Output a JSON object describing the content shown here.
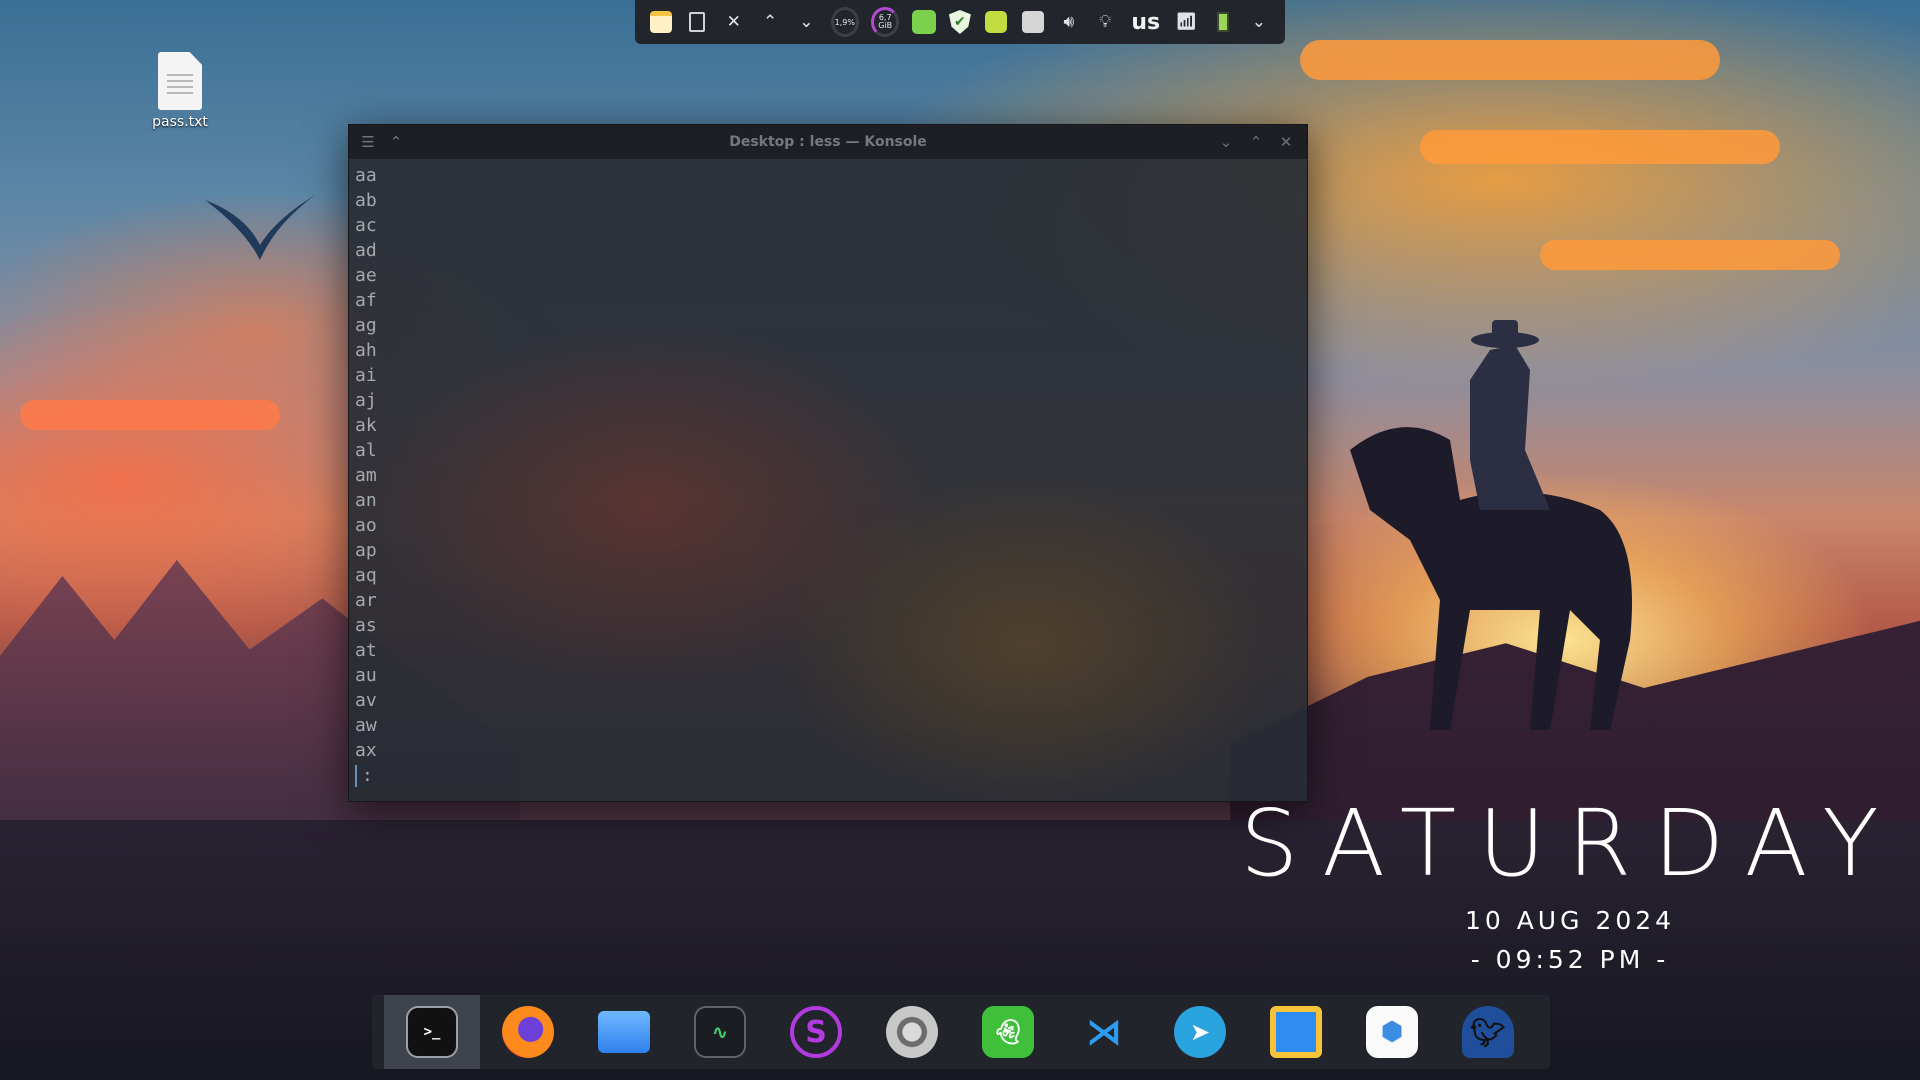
{
  "top_panel": {
    "cpu_usage": "1,9%",
    "mem_usage_value": "6,7",
    "mem_usage_unit": "GiB",
    "keyboard_layout": "us"
  },
  "desktop": {
    "icons": [
      {
        "label": "pass.txt",
        "icon": "text-file-icon"
      }
    ]
  },
  "konsole": {
    "title": "Desktop : less — Konsole",
    "lines": [
      "aa",
      "ab",
      "ac",
      "ad",
      "ae",
      "af",
      "ag",
      "ah",
      "ai",
      "aj",
      "ak",
      "al",
      "am",
      "an",
      "ao",
      "ap",
      "aq",
      "ar",
      "as",
      "at",
      "au",
      "av",
      "aw",
      "ax"
    ],
    "prompt": ":"
  },
  "clock": {
    "day": "SATURDAY",
    "date": "10 AUG 2024",
    "time": "- 09:52 PM -"
  },
  "dock": {
    "apps": [
      "terminal-icon",
      "firefox-icon",
      "files-icon",
      "system-monitor-icon",
      "stacer-icon",
      "settings-icon",
      "ghost-app-icon",
      "vscode-icon",
      "telegram-icon",
      "calendar-icon",
      "hex-app-icon",
      "crow-app-icon"
    ]
  }
}
